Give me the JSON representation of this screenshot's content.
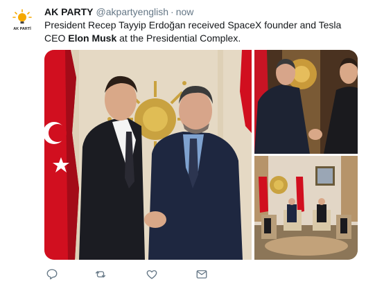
{
  "tweet": {
    "author_name": "AK PARTY",
    "author_handle": "@akpartyenglish",
    "separator": "·",
    "time": "now",
    "avatar_label": "AK PARTİ",
    "text_before": "President Recep Tayyip Erdoğan received SpaceX founder and Tesla CEO ",
    "text_bold": "Elon Musk",
    "text_after": " at the Presidential Complex."
  },
  "actions": [
    {
      "icon": "reply-icon"
    },
    {
      "icon": "retweet-icon"
    },
    {
      "icon": "like-icon"
    },
    {
      "icon": "direct-message-icon"
    }
  ],
  "colors": {
    "icon_gray": "#657786",
    "flag_red": "#e30a17",
    "logo_yellow": "#f5a800"
  }
}
